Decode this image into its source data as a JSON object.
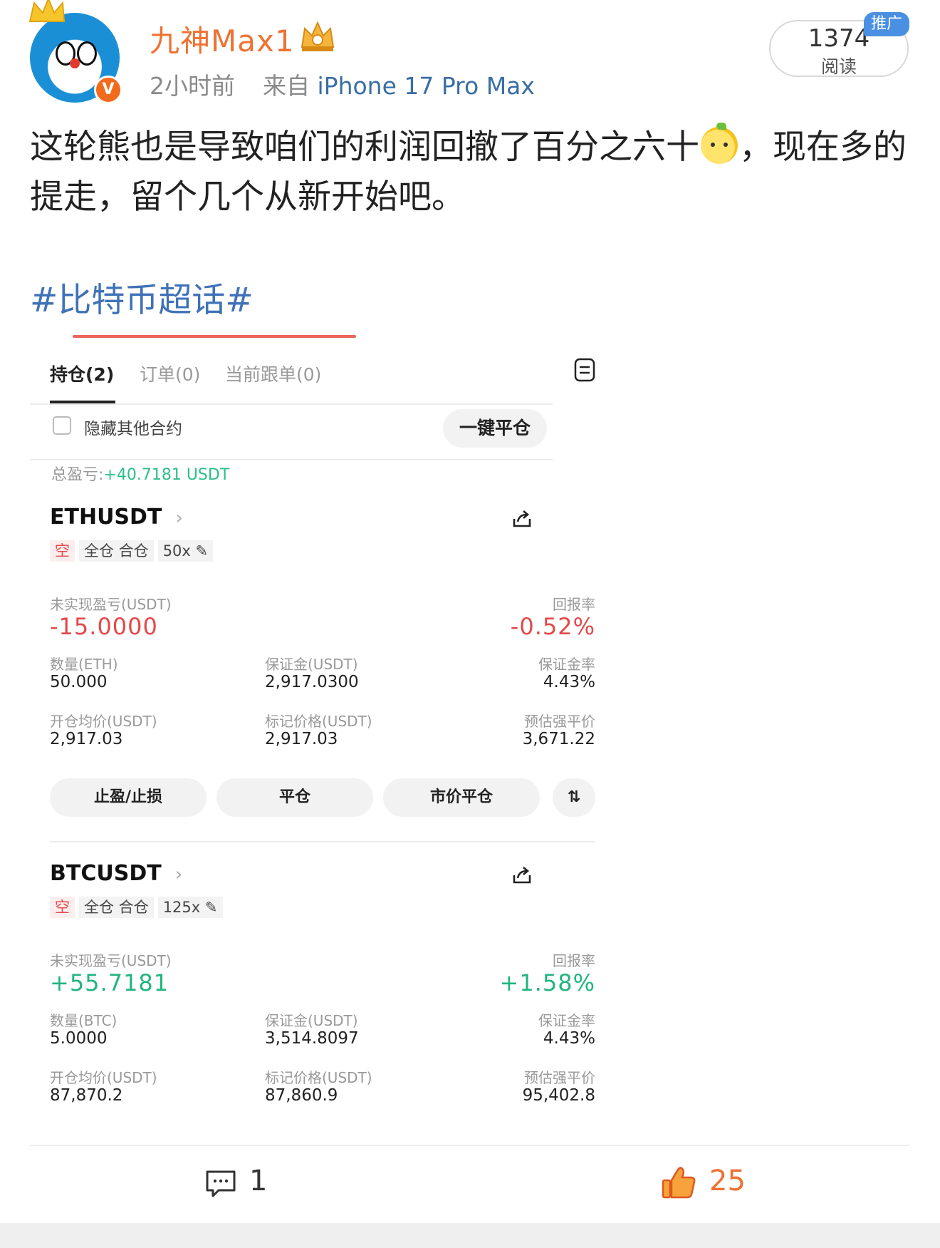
{
  "post": {
    "username": "九神Max1",
    "time": "2小时前",
    "source_prefix": "来自",
    "device": "iPhone 17 Pro Max",
    "read_count": "1374",
    "read_label": "阅读",
    "promo_badge": "推广",
    "text_part1": "这轮熊也是导致咱们的利润回撤了百分之六十",
    "text_part2": "，现在多的提走，留个几个从新开始吧。",
    "hashtag": "#比特币超话#"
  },
  "screenshot": {
    "tabs": [
      {
        "label": "持仓(2)",
        "active": true
      },
      {
        "label": "订单(0)",
        "active": false
      },
      {
        "label": "当前跟单(0)",
        "active": false
      }
    ],
    "hide_other_label": "隐藏其他合约",
    "close_all_label": "一键平仓",
    "total_pnl_label": "总盈亏:",
    "total_pnl_value": "+40.7181 USDT",
    "positions": [
      {
        "symbol": "ETHUSDT",
        "tags": [
          "空",
          "全仓 合仓",
          "50x"
        ],
        "unrealized_label": "未实现盈亏(USDT)",
        "unrealized_value": "-15.0000",
        "roe_label": "回报率",
        "roe_value": "-0.52%",
        "qty_label": "数量(ETH)",
        "qty_value": "50.000",
        "margin_label": "保证金(USDT)",
        "margin_value": "2,917.0300",
        "margin_ratio_label": "保证金率",
        "margin_ratio_value": "4.43%",
        "entry_label": "开仓均价(USDT)",
        "entry_value": "2,917.03",
        "mark_label": "标记价格(USDT)",
        "mark_value": "2,917.03",
        "liq_label": "预估强平价",
        "liq_value": "3,671.22"
      },
      {
        "symbol": "BTCUSDT",
        "tags": [
          "空",
          "全仓 合仓",
          "125x"
        ],
        "unrealized_label": "未实现盈亏(USDT)",
        "unrealized_value": "+55.7181",
        "roe_label": "回报率",
        "roe_value": "+1.58%",
        "qty_label": "数量(BTC)",
        "qty_value": "5.0000",
        "margin_label": "保证金(USDT)",
        "margin_value": "3,514.8097",
        "margin_ratio_label": "保证金率",
        "margin_ratio_value": "4.43%",
        "entry_label": "开仓均价(USDT)",
        "entry_value": "87,870.2",
        "mark_label": "标记价格(USDT)",
        "mark_value": "87,860.9",
        "liq_label": "预估强平价",
        "liq_value": "95,402.8"
      }
    ],
    "actions": [
      "止盈/止损",
      "平仓",
      "市价平仓"
    ]
  },
  "footer": {
    "comment_count": "1",
    "like_count": "25"
  },
  "colors": {
    "username": "#ee7233",
    "hashtag": "#3f72b8",
    "loss": "#e3494a",
    "profit": "#22b57f"
  }
}
